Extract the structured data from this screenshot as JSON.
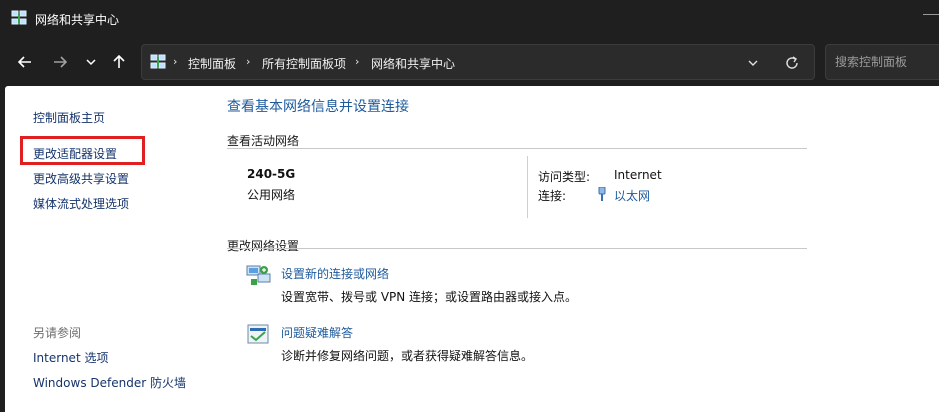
{
  "window": {
    "title": "网络和共享中心"
  },
  "nav": {
    "breadcrumbs": [
      "控制面板",
      "所有控制面板项",
      "网络和共享中心"
    ],
    "search_placeholder": "搜索控制面板"
  },
  "left_pane": {
    "items": [
      "控制面板主页",
      "更改适配器设置",
      "更改高级共享设置",
      "媒体流式处理选项"
    ],
    "see_also_label": "另请参阅",
    "see_also_items": [
      "Internet 选项",
      "Windows Defender 防火墙"
    ]
  },
  "main": {
    "title": "查看基本网络信息并设置连接",
    "active_networks_label": "查看活动网络",
    "network": {
      "name": "240-5G",
      "profile": "公用网络",
      "access_type_label": "访问类型:",
      "access_type_value": "Internet",
      "connections_label": "连接:",
      "connections_value": "以太网"
    },
    "change_settings_label": "更改网络设置",
    "tasks": [
      {
        "link": "设置新的连接或网络",
        "desc": "设置宽带、拨号或 VPN 连接；或设置路由器或接入点。",
        "icon": "network-setup-icon"
      },
      {
        "link": "问题疑难解答",
        "desc": "诊断并修复网络问题，或者获得疑难解答信息。",
        "icon": "troubleshoot-icon"
      }
    ]
  },
  "colors": {
    "accent_link": "#1e5a9c",
    "highlight": "#e02020",
    "chrome": "#1f1f1f"
  }
}
